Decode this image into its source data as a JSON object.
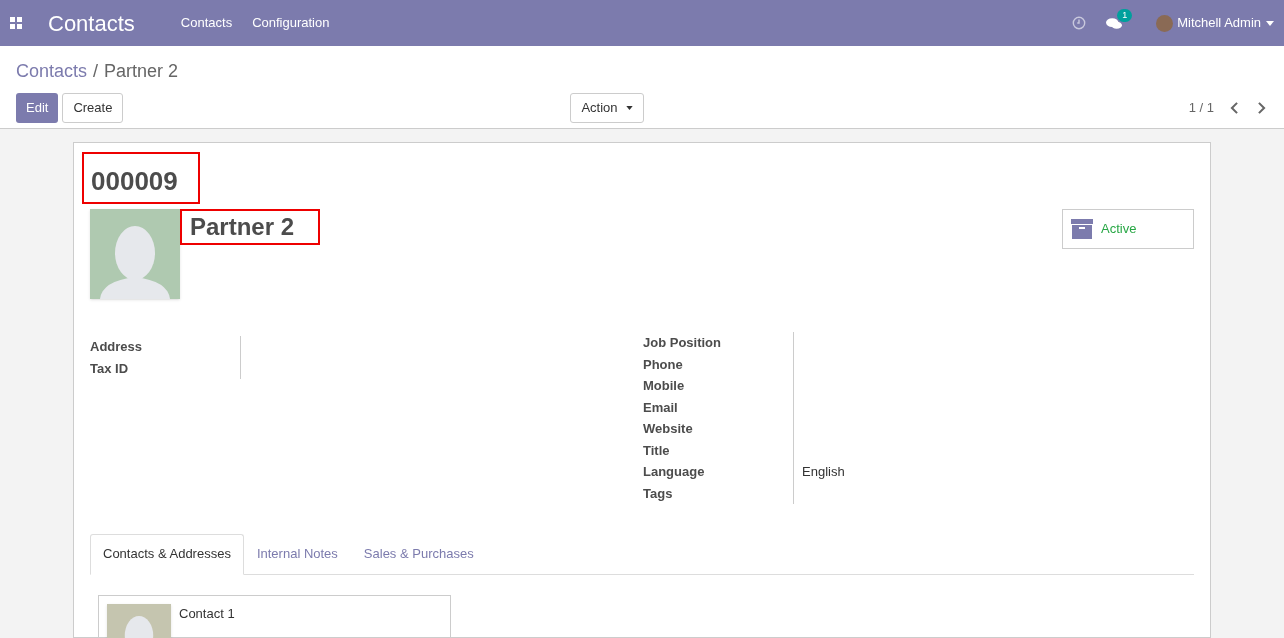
{
  "navbar": {
    "app_title": "Contacts",
    "menu": [
      "Contacts",
      "Configuration"
    ],
    "messages_badge": "1",
    "user": "Mitchell Admin"
  },
  "breadcrumb": {
    "parent": "Contacts",
    "separator": "/",
    "current": "Partner 2"
  },
  "buttons": {
    "edit": "Edit",
    "create": "Create",
    "action": "Action"
  },
  "pager": "1 / 1",
  "record": {
    "reference": "000009",
    "name": "Partner 2",
    "status": "Active"
  },
  "left_fields": [
    {
      "label": "Address"
    },
    {
      "label": "Tax ID"
    }
  ],
  "right_fields": [
    {
      "label": "Job Position"
    },
    {
      "label": "Phone"
    },
    {
      "label": "Mobile"
    },
    {
      "label": "Email"
    },
    {
      "label": "Website"
    },
    {
      "label": "Title"
    },
    {
      "label": "Language",
      "value": "English"
    },
    {
      "label": "Tags"
    }
  ],
  "tabs": [
    {
      "label": "Contacts & Addresses",
      "selected": true
    },
    {
      "label": "Internal Notes",
      "selected": false
    },
    {
      "label": "Sales & Purchases",
      "selected": false
    }
  ],
  "contacts": [
    {
      "name": "Contact 1"
    }
  ]
}
